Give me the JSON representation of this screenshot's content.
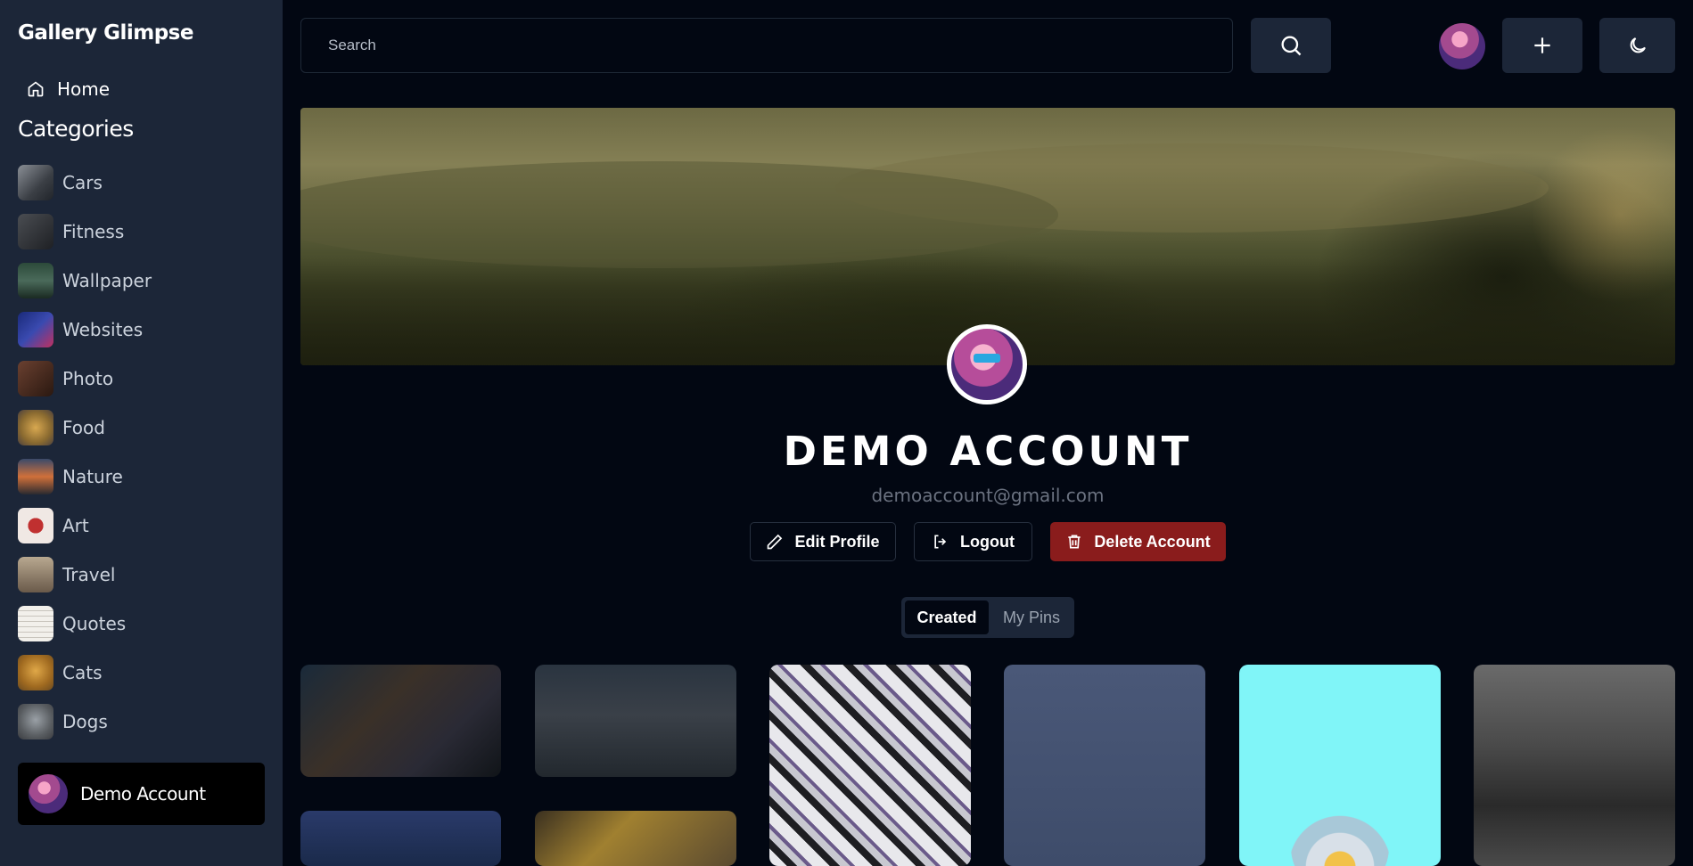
{
  "app": {
    "brand": "Gallery Glimpse"
  },
  "sidebar": {
    "home_label": "Home",
    "categories_title": "Categories",
    "categories": [
      {
        "label": "Cars",
        "color": "#5a5f66"
      },
      {
        "label": "Fitness",
        "color": "#3a3d42"
      },
      {
        "label": "Wallpaper",
        "color": "#2e4a3a"
      },
      {
        "label": "Websites",
        "color": "#2a3a8a"
      },
      {
        "label": "Photo",
        "color": "#4a3024"
      },
      {
        "label": "Food",
        "color": "#9a7a3a"
      },
      {
        "label": "Nature",
        "color": "#b06a3a"
      },
      {
        "label": "Art",
        "color": "#e8d8d0"
      },
      {
        "label": "Travel",
        "color": "#7a6a5a"
      },
      {
        "label": "Quotes",
        "color": "#e6e4df"
      },
      {
        "label": "Cats",
        "color": "#c8903a"
      },
      {
        "label": "Dogs",
        "color": "#7a7d80"
      }
    ],
    "account_name": "Demo Account"
  },
  "topbar": {
    "search_placeholder": "Search"
  },
  "profile": {
    "name": "DEMO ACCOUNT",
    "email": "demoaccount@gmail.com",
    "edit_label": "Edit Profile",
    "logout_label": "Logout",
    "delete_label": "Delete Account"
  },
  "tabs": {
    "created_label": "Created",
    "pins_label": "My Pins"
  },
  "colors": {
    "bg": "#020712",
    "sidebar": "#1c2638",
    "danger": "#8a1c1c"
  }
}
